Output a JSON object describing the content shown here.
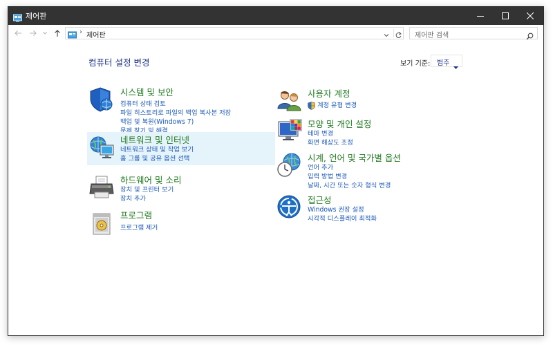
{
  "window": {
    "title": "제어판",
    "minimize_icon": "minimize-icon",
    "maximize_icon": "maximize-icon",
    "close_icon": "close-icon"
  },
  "address_bar": {
    "path": "제어판",
    "separator": "›",
    "back_icon": "arrow-left-icon",
    "forward_icon": "arrow-right-icon",
    "recent_icon": "chevron-down-icon",
    "up_icon": "arrow-up-icon",
    "refresh_icon": "refresh-icon"
  },
  "search": {
    "placeholder": "제어판 검색",
    "icon": "search-icon"
  },
  "header": {
    "title": "컴퓨터 설정 변경",
    "view_by_label": "보기 기준:",
    "view_by_value": "범주"
  },
  "categories_left": [
    {
      "title": "시스템 및 보안",
      "icon": "shield-globe-icon",
      "links": [
        "컴퓨터 상태 검토",
        "파일 히스토리로 파일의 백업 복사본 저장",
        "백업 및 복원(Windows 7)",
        "문제 찾기 및 해결"
      ]
    },
    {
      "title": "네트워크 및 인터넷",
      "icon": "network-globe-icon",
      "links": [
        "네트워크 상태 및 작업 보기",
        "홈 그룹 및 공유 옵션 선택"
      ]
    },
    {
      "title": "하드웨어 및 소리",
      "icon": "printer-icon",
      "links": [
        "장치 및 프린터 보기",
        "장치 추가"
      ]
    },
    {
      "title": "프로그램",
      "icon": "program-disc-icon",
      "links": [
        "프로그램 제거"
      ]
    }
  ],
  "categories_right": [
    {
      "title": "사용자 계정",
      "icon": "users-icon",
      "links": [
        "계정 유형 변경"
      ]
    },
    {
      "title": "모양 및 개인 설정",
      "icon": "monitor-palette-icon",
      "links": [
        "테마 변경",
        "화면 해상도 조정"
      ]
    },
    {
      "title": "시계, 언어 및 국가별 옵션",
      "icon": "clock-globe-icon",
      "links": [
        "언어 추가",
        "입력 방법 변경",
        "날짜, 시간 또는 숫자 형식 변경"
      ]
    },
    {
      "title": "접근성",
      "icon": "ease-of-access-icon",
      "links": [
        "Windows 권장 설정",
        "시각적 디스플레이 최적화"
      ]
    }
  ],
  "colors": {
    "title_bar": "#333333",
    "category_title": "#227a22",
    "link": "#1c58b8",
    "header": "#1e3287",
    "hover_highlight": "#e5f3fb"
  }
}
